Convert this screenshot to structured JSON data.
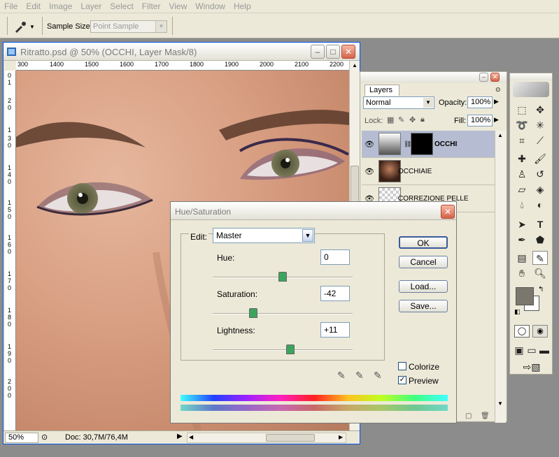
{
  "menu": [
    "File",
    "Edit",
    "Image",
    "Layer",
    "Select",
    "Filter",
    "View",
    "Window",
    "Help"
  ],
  "options": {
    "sample_size_label": "Sample Size:",
    "sample_size_value": "Point Sample"
  },
  "document": {
    "title": "Ritratto.psd @ 50% (OCCHI, Layer Mask/8)",
    "ruler_h": [
      "300",
      "1400",
      "1500",
      "1600",
      "1700",
      "1800",
      "1900",
      "2000",
      "2100",
      "2200"
    ],
    "ruler_v": [
      "0",
      "1",
      "2",
      "0",
      "1",
      "3",
      "0",
      "1",
      "4",
      "0",
      "1",
      "5",
      "0",
      "1",
      "6",
      "0",
      "1",
      "7",
      "0",
      "1",
      "8",
      "0",
      "1",
      "9",
      "0",
      "2",
      "0",
      "0"
    ],
    "zoom": "50%",
    "doc_size": "Doc: 30,7M/76,4M"
  },
  "layers": {
    "tab": "Layers",
    "blend_mode": "Normal",
    "opacity_label": "Opacity:",
    "opacity": "100%",
    "lock_label": "Lock:",
    "fill_label": "Fill:",
    "fill": "100%",
    "items": [
      {
        "name": "OCCHI"
      },
      {
        "name": "OCCHIAIE"
      },
      {
        "name": "CORREZIONE PELLE"
      }
    ]
  },
  "hue_sat": {
    "title": "Hue/Saturation",
    "edit_label": "Edit:",
    "edit_value": "Master",
    "hue_label": "Hue:",
    "hue": "0",
    "hue_level": 0.5,
    "saturation_label": "Saturation:",
    "saturation": "-42",
    "saturation_level": 0.29,
    "lightness_label": "Lightness:",
    "lightness": "+11",
    "lightness_level": 0.555,
    "ok": "OK",
    "cancel": "Cancel",
    "load": "Load...",
    "save": "Save...",
    "colorize": "Colorize",
    "colorize_checked": false,
    "preview": "Preview",
    "preview_checked": true
  }
}
